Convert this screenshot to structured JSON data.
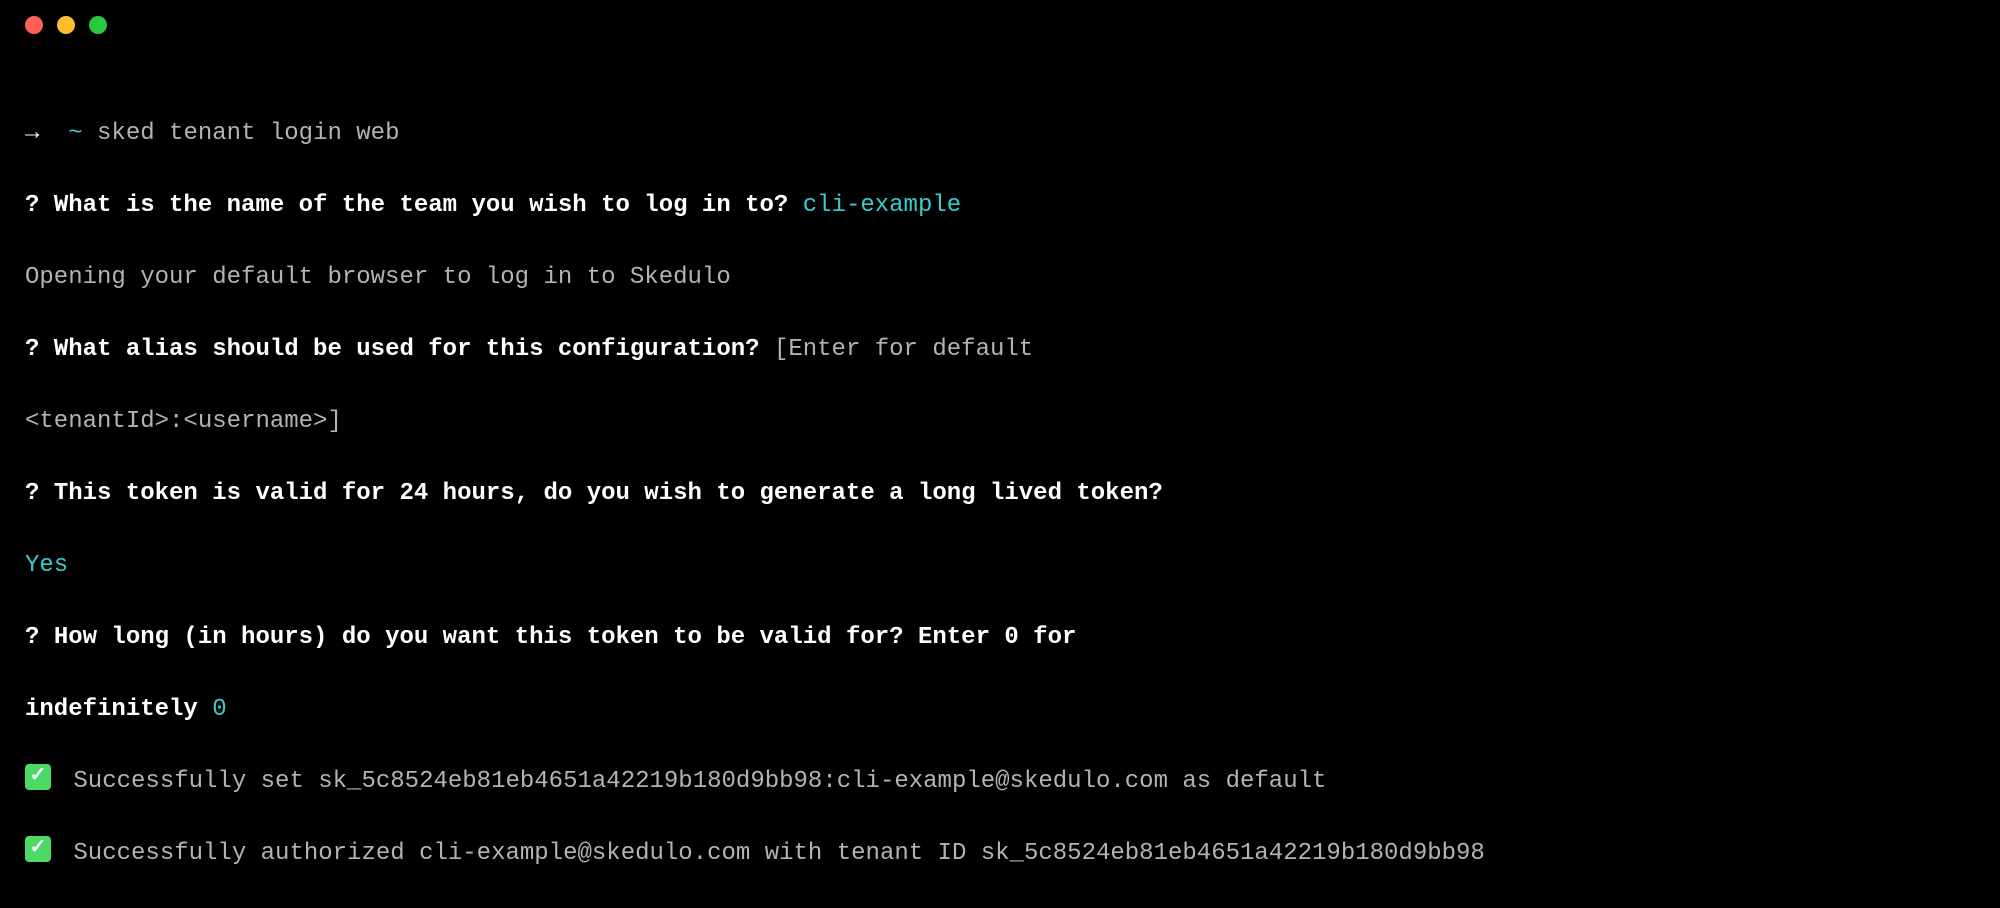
{
  "titlebar": {
    "close": "close",
    "minimize": "minimize",
    "maximize": "maximize"
  },
  "terminal": {
    "prompt_arrow": "→  ",
    "prompt_path": "~",
    "command": " sked tenant login web",
    "q1_prefix": "?",
    "q1_text": " What is the name of the team you wish to log in to? ",
    "q1_answer": "cli-example",
    "opening_browser": "Opening your default browser to log in to Skedulo",
    "q2_prefix": "?",
    "q2_text": " What alias should be used for this configuration? ",
    "q2_hint": "[Enter for default ",
    "q2_hint_line2": "<tenantId>:<username>]",
    "q3_prefix": "?",
    "q3_text": " This token is valid for 24 hours, do you wish to generate a long lived token? ",
    "q3_answer": "Yes",
    "q4_prefix": "?",
    "q4_text": " How long (in hours) do you want this token to be valid for? Enter 0 for ",
    "q4_text_line2": "indefinitely ",
    "q4_answer": "0",
    "success1": " Successfully set sk_5c8524eb81eb4651a42219b180d9bb98:cli-example@skedulo.com as default",
    "success2": " Successfully authorized cli-example@skedulo.com with tenant ID sk_5c8524eb81eb4651a42219b180d9bb98"
  }
}
